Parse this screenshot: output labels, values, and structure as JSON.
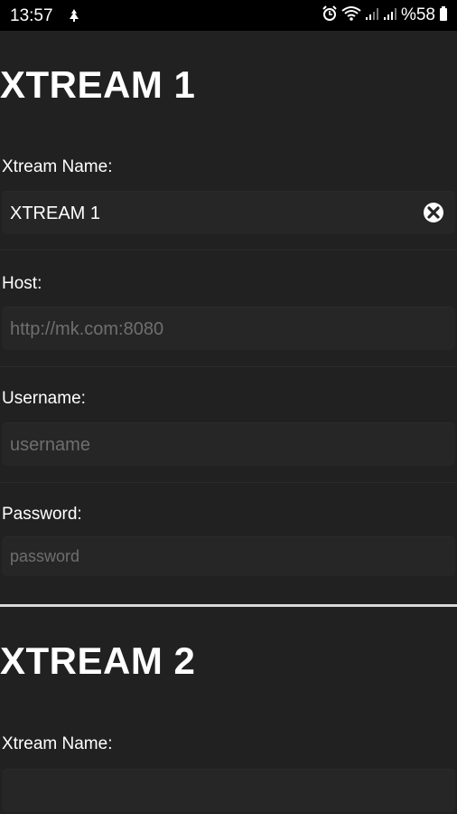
{
  "status_bar": {
    "time": "13:57",
    "battery": "%58",
    "icons": [
      "notification-icon",
      "alarm-icon",
      "wifi-icon",
      "signal-icon",
      "signal-icon",
      "battery-icon"
    ]
  },
  "xtream1": {
    "title": "XTREAM 1",
    "name_label": "Xtream Name:",
    "name_value": "XTREAM 1",
    "host_label": "Host:",
    "host_placeholder": "http://mk.com:8080",
    "username_label": "Username:",
    "username_placeholder": "username",
    "password_label": "Password:",
    "password_placeholder": "password"
  },
  "xtream2": {
    "title": "XTREAM 2",
    "name_label": "Xtream Name:",
    "name_value": ""
  }
}
